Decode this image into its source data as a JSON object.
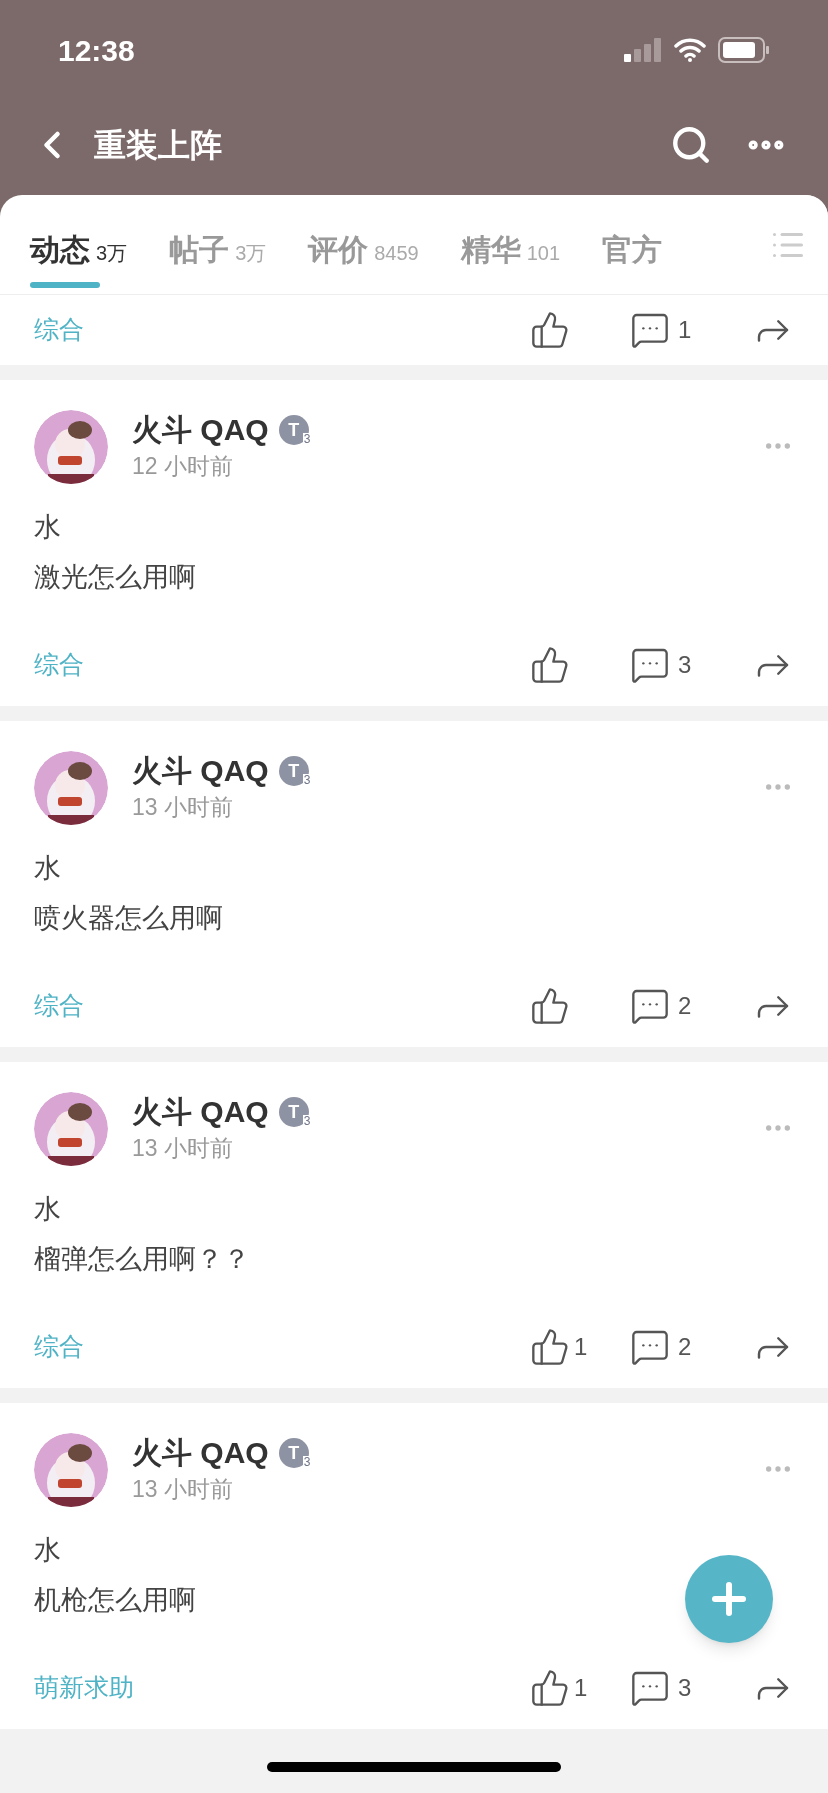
{
  "status_bar": {
    "time": "12:38"
  },
  "header": {
    "title": "重装上阵"
  },
  "tabs": [
    {
      "label": "动态",
      "count": "3万",
      "selected": true
    },
    {
      "label": "帖子",
      "count": "3万",
      "selected": false
    },
    {
      "label": "评价",
      "count": "8459",
      "selected": false
    },
    {
      "label": "精华",
      "count": "101",
      "selected": false
    },
    {
      "label": "官方",
      "selected": false
    }
  ],
  "partial_post": {
    "tag": "综合",
    "comments": "1"
  },
  "posts": [
    {
      "author": "火斗 QAQ",
      "badge": "T",
      "badge_level": "3",
      "time": "12 小时前",
      "lines": [
        "水",
        "激光怎么用啊"
      ],
      "tag": "综合",
      "comments": "3"
    },
    {
      "author": "火斗 QAQ",
      "badge": "T",
      "badge_level": "3",
      "time": "13 小时前",
      "lines": [
        "水",
        "喷火器怎么用啊"
      ],
      "tag": "综合",
      "comments": "2"
    },
    {
      "author": "火斗 QAQ",
      "badge": "T",
      "badge_level": "3",
      "time": "13 小时前",
      "lines": [
        "水",
        "榴弹怎么用啊？？"
      ],
      "tag": "综合",
      "likes": "1",
      "comments": "2"
    },
    {
      "author": "火斗 QAQ",
      "badge": "T",
      "badge_level": "3",
      "time": "13 小时前",
      "lines": [
        "水",
        "机枪怎么用啊"
      ],
      "tag": "萌新求助",
      "likes": "1",
      "comments": "3"
    }
  ]
}
